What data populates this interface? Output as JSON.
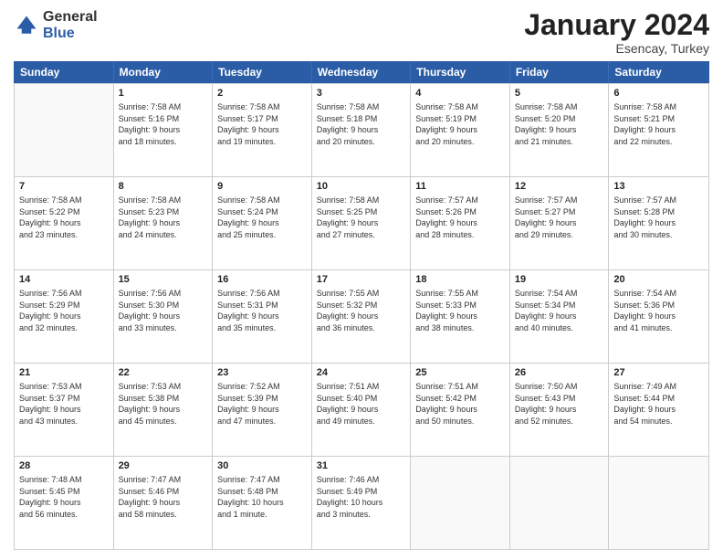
{
  "logo": {
    "general": "General",
    "blue": "Blue"
  },
  "title": {
    "month": "January 2024",
    "location": "Esencay, Turkey"
  },
  "header": {
    "days": [
      "Sunday",
      "Monday",
      "Tuesday",
      "Wednesday",
      "Thursday",
      "Friday",
      "Saturday"
    ]
  },
  "weeks": [
    [
      {
        "day": "",
        "info": ""
      },
      {
        "day": "1",
        "info": "Sunrise: 7:58 AM\nSunset: 5:16 PM\nDaylight: 9 hours\nand 18 minutes."
      },
      {
        "day": "2",
        "info": "Sunrise: 7:58 AM\nSunset: 5:17 PM\nDaylight: 9 hours\nand 19 minutes."
      },
      {
        "day": "3",
        "info": "Sunrise: 7:58 AM\nSunset: 5:18 PM\nDaylight: 9 hours\nand 20 minutes."
      },
      {
        "day": "4",
        "info": "Sunrise: 7:58 AM\nSunset: 5:19 PM\nDaylight: 9 hours\nand 20 minutes."
      },
      {
        "day": "5",
        "info": "Sunrise: 7:58 AM\nSunset: 5:20 PM\nDaylight: 9 hours\nand 21 minutes."
      },
      {
        "day": "6",
        "info": "Sunrise: 7:58 AM\nSunset: 5:21 PM\nDaylight: 9 hours\nand 22 minutes."
      }
    ],
    [
      {
        "day": "7",
        "info": "Sunrise: 7:58 AM\nSunset: 5:22 PM\nDaylight: 9 hours\nand 23 minutes."
      },
      {
        "day": "8",
        "info": "Sunrise: 7:58 AM\nSunset: 5:23 PM\nDaylight: 9 hours\nand 24 minutes."
      },
      {
        "day": "9",
        "info": "Sunrise: 7:58 AM\nSunset: 5:24 PM\nDaylight: 9 hours\nand 25 minutes."
      },
      {
        "day": "10",
        "info": "Sunrise: 7:58 AM\nSunset: 5:25 PM\nDaylight: 9 hours\nand 27 minutes."
      },
      {
        "day": "11",
        "info": "Sunrise: 7:57 AM\nSunset: 5:26 PM\nDaylight: 9 hours\nand 28 minutes."
      },
      {
        "day": "12",
        "info": "Sunrise: 7:57 AM\nSunset: 5:27 PM\nDaylight: 9 hours\nand 29 minutes."
      },
      {
        "day": "13",
        "info": "Sunrise: 7:57 AM\nSunset: 5:28 PM\nDaylight: 9 hours\nand 30 minutes."
      }
    ],
    [
      {
        "day": "14",
        "info": "Sunrise: 7:56 AM\nSunset: 5:29 PM\nDaylight: 9 hours\nand 32 minutes."
      },
      {
        "day": "15",
        "info": "Sunrise: 7:56 AM\nSunset: 5:30 PM\nDaylight: 9 hours\nand 33 minutes."
      },
      {
        "day": "16",
        "info": "Sunrise: 7:56 AM\nSunset: 5:31 PM\nDaylight: 9 hours\nand 35 minutes."
      },
      {
        "day": "17",
        "info": "Sunrise: 7:55 AM\nSunset: 5:32 PM\nDaylight: 9 hours\nand 36 minutes."
      },
      {
        "day": "18",
        "info": "Sunrise: 7:55 AM\nSunset: 5:33 PM\nDaylight: 9 hours\nand 38 minutes."
      },
      {
        "day": "19",
        "info": "Sunrise: 7:54 AM\nSunset: 5:34 PM\nDaylight: 9 hours\nand 40 minutes."
      },
      {
        "day": "20",
        "info": "Sunrise: 7:54 AM\nSunset: 5:36 PM\nDaylight: 9 hours\nand 41 minutes."
      }
    ],
    [
      {
        "day": "21",
        "info": "Sunrise: 7:53 AM\nSunset: 5:37 PM\nDaylight: 9 hours\nand 43 minutes."
      },
      {
        "day": "22",
        "info": "Sunrise: 7:53 AM\nSunset: 5:38 PM\nDaylight: 9 hours\nand 45 minutes."
      },
      {
        "day": "23",
        "info": "Sunrise: 7:52 AM\nSunset: 5:39 PM\nDaylight: 9 hours\nand 47 minutes."
      },
      {
        "day": "24",
        "info": "Sunrise: 7:51 AM\nSunset: 5:40 PM\nDaylight: 9 hours\nand 49 minutes."
      },
      {
        "day": "25",
        "info": "Sunrise: 7:51 AM\nSunset: 5:42 PM\nDaylight: 9 hours\nand 50 minutes."
      },
      {
        "day": "26",
        "info": "Sunrise: 7:50 AM\nSunset: 5:43 PM\nDaylight: 9 hours\nand 52 minutes."
      },
      {
        "day": "27",
        "info": "Sunrise: 7:49 AM\nSunset: 5:44 PM\nDaylight: 9 hours\nand 54 minutes."
      }
    ],
    [
      {
        "day": "28",
        "info": "Sunrise: 7:48 AM\nSunset: 5:45 PM\nDaylight: 9 hours\nand 56 minutes."
      },
      {
        "day": "29",
        "info": "Sunrise: 7:47 AM\nSunset: 5:46 PM\nDaylight: 9 hours\nand 58 minutes."
      },
      {
        "day": "30",
        "info": "Sunrise: 7:47 AM\nSunset: 5:48 PM\nDaylight: 10 hours\nand 1 minute."
      },
      {
        "day": "31",
        "info": "Sunrise: 7:46 AM\nSunset: 5:49 PM\nDaylight: 10 hours\nand 3 minutes."
      },
      {
        "day": "",
        "info": ""
      },
      {
        "day": "",
        "info": ""
      },
      {
        "day": "",
        "info": ""
      }
    ]
  ]
}
